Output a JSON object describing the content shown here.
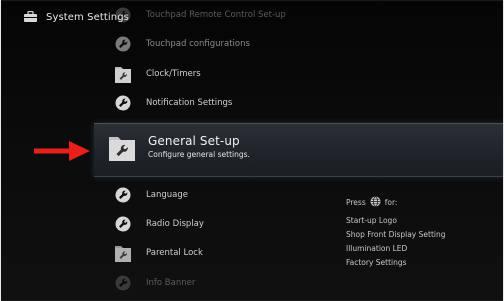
{
  "header": {
    "title": "System Settings",
    "icon": "toolbox-icon"
  },
  "menu": {
    "items_above": [
      {
        "label": "Touchpad Remote Control Set-up",
        "icon": "wrench-icon",
        "state": "faded"
      },
      {
        "label": "Touchpad configurations",
        "icon": "wrench-icon",
        "state": "dim"
      },
      {
        "label": "Clock/Timers",
        "icon": "folder-wrench-icon",
        "state": "normal"
      },
      {
        "label": "Notification Settings",
        "icon": "wrench-icon",
        "state": "normal"
      }
    ],
    "selected": {
      "label": "General Set-up",
      "description": "Configure general settings.",
      "icon": "folder-wrench-icon"
    },
    "items_below": [
      {
        "label": "Language",
        "icon": "wrench-icon",
        "state": "normal"
      },
      {
        "label": "Radio Display",
        "icon": "wrench-icon",
        "state": "normal"
      },
      {
        "label": "Parental Lock",
        "icon": "folder-wrench-icon",
        "state": "normal"
      },
      {
        "label": "Info Banner",
        "icon": "wrench-icon",
        "state": "faded"
      }
    ]
  },
  "help": {
    "press_label": "Press",
    "for_label": "for:",
    "options_icon": "options-globe-icon",
    "items": [
      "Start-up Logo",
      "Shop Front Display Setting",
      "Illumination LED",
      "Factory Settings"
    ]
  },
  "annotation": {
    "arrow_color": "#e8201c",
    "arrow_icon": "red-arrow-icon"
  },
  "colors": {
    "background": "#0b0b0b",
    "selected_band": "#232a30",
    "text": "#cfcfcf"
  }
}
